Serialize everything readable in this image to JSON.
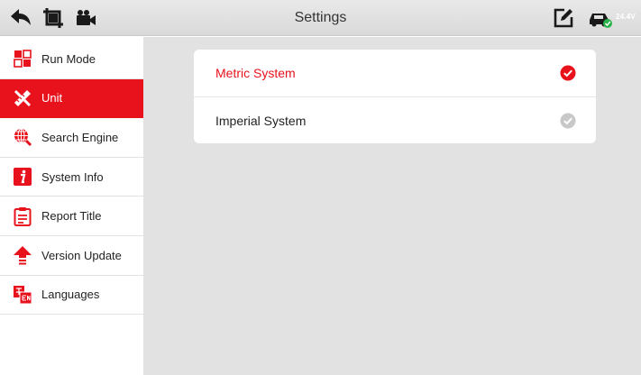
{
  "header": {
    "title": "Settings",
    "voltage": "24.4V",
    "icons": [
      "back-icon",
      "screenshot-icon",
      "record-icon",
      "edit-icon",
      "vehicle-icon"
    ]
  },
  "sidebar": {
    "items": [
      {
        "label": "Run Mode",
        "icon": "run-mode-icon",
        "active": false
      },
      {
        "label": "Unit",
        "icon": "unit-icon",
        "active": true
      },
      {
        "label": "Search Engine",
        "icon": "search-engine-icon",
        "active": false
      },
      {
        "label": "System Info",
        "icon": "system-info-icon",
        "active": false
      },
      {
        "label": "Report Title",
        "icon": "report-title-icon",
        "active": false
      },
      {
        "label": "Version Update",
        "icon": "version-update-icon",
        "active": false
      },
      {
        "label": "Languages",
        "icon": "languages-icon",
        "active": false
      }
    ]
  },
  "unit": {
    "options": [
      {
        "label": "Metric System",
        "selected": true
      },
      {
        "label": "Imperial System",
        "selected": false
      }
    ]
  },
  "colors": {
    "accent": "#e8121c",
    "content_background": "#e2e2e2",
    "check_inactive": "#c8c8c8",
    "battery_ok": "#2bb34a"
  }
}
